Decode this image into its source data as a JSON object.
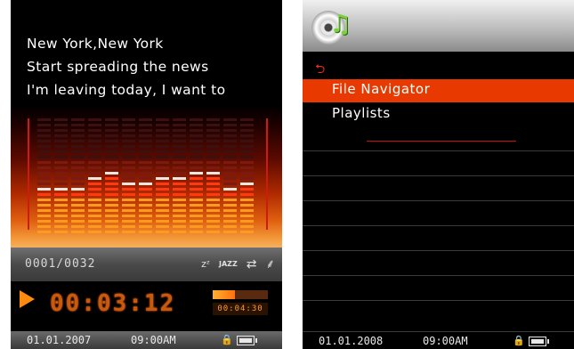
{
  "left_screen": {
    "lyrics": [
      "New York,New York",
      "Start spreading the news",
      "I'm leaving today, I want to"
    ],
    "track_counter": "0001/0032",
    "mode_icons": [
      {
        "name": "sleep-icon",
        "glyph": "zᶻ"
      },
      {
        "name": "jazz-eq-icon",
        "glyph": "JAZZ"
      },
      {
        "name": "repeat-icon",
        "glyph": "⇄"
      },
      {
        "name": "speed-icon",
        "glyph": "⸙"
      }
    ],
    "play_icon": "play-icon",
    "elapsed_display": "00:03:12",
    "progress_fraction": 0.4,
    "total_time": "00:04:30",
    "date": "01.01.2007",
    "time": "09:00AM",
    "accent_color": "#ff8a10"
  },
  "right_screen": {
    "header_icons": [
      "cd-icon",
      "music-note-icon"
    ],
    "back_icon": "back-arrow-icon",
    "menu_items": [
      "File Navigator",
      "Playlists"
    ],
    "selected_index": 0,
    "date": "01.01.2008",
    "time": "09:00AM",
    "highlight_color": "#e83a00"
  }
}
